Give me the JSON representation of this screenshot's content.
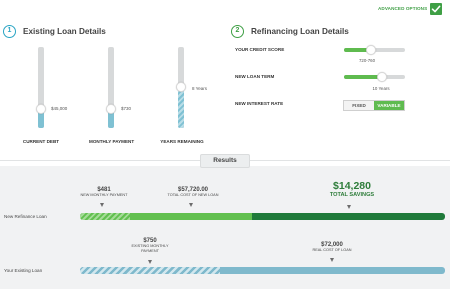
{
  "header": {
    "advanced_options": "ADVANCED OPTIONS",
    "advanced_checked": true
  },
  "existing": {
    "number": "1",
    "title": "Existing Loan Details",
    "sliders": [
      {
        "label": "CURRENT DEBT",
        "value": "$45,000",
        "level": 0.24
      },
      {
        "label": "MONTHLY PAYMENT",
        "value": "$730",
        "level": 0.24
      },
      {
        "label": "YEARS REMAINING",
        "value": "8 Years",
        "level": 0.5
      }
    ]
  },
  "refinancing": {
    "number": "2",
    "title": "Refinancing Loan Details",
    "credit_score": {
      "label": "YOUR CREDIT SCORE",
      "value": "720-760",
      "level": 0.45
    },
    "loan_term": {
      "label": "NEW LOAN TERM",
      "value": "10 Years",
      "level": 0.62
    },
    "interest_rate": {
      "label": "NEW INTEREST RATE",
      "options": [
        "FIXED",
        "VARIABLE"
      ],
      "selected": "VARIABLE"
    }
  },
  "results": {
    "tab": "Results",
    "new_loan": {
      "label": "New Refinance Loan",
      "monthly_amount": "$481",
      "monthly_label": "NEW MONTHLY PAYMENT",
      "total_amount": "$57,720.00",
      "total_label": "TOTAL COST OF NEW LOAN",
      "savings_amount": "$14,280",
      "savings_label": "TOTAL SAVINGS"
    },
    "existing_loan": {
      "label": "Your Existing Loan",
      "monthly_amount": "$750",
      "monthly_label": "EXISTING MONTHLY PAYMENT",
      "total_amount": "$72,000",
      "total_label": "REAL COST OF LOAN"
    }
  },
  "colors": {
    "accent_blue": "#2aa5c4",
    "accent_green": "#3f9f45",
    "dark_green": "#1f7a3a",
    "light_green": "#62c04f",
    "bar_blue": "#7fb9cc"
  }
}
